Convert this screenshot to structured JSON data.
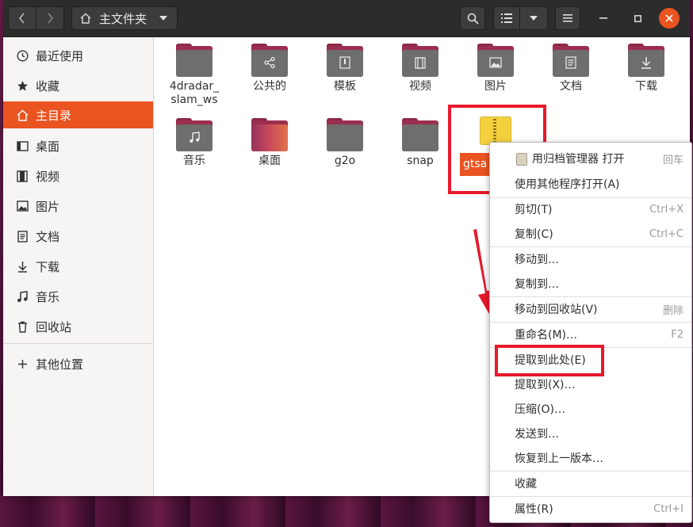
{
  "header": {
    "back_icon": "chevron-left-icon",
    "forward_icon": "chevron-right-icon",
    "path_label": "主文件夹",
    "home_icon": "home-icon"
  },
  "sidebar": {
    "items": [
      {
        "label": "最近使用",
        "icon": "clock-icon"
      },
      {
        "label": "收藏",
        "icon": "star-icon"
      },
      {
        "label": "主目录",
        "icon": "home-icon"
      },
      {
        "label": "桌面",
        "icon": "desktop-icon"
      },
      {
        "label": "视频",
        "icon": "video-icon"
      },
      {
        "label": "图片",
        "icon": "image-icon"
      },
      {
        "label": "文档",
        "icon": "document-icon"
      },
      {
        "label": "下载",
        "icon": "download-icon"
      },
      {
        "label": "音乐",
        "icon": "music-icon"
      },
      {
        "label": "回收站",
        "icon": "trash-icon"
      },
      {
        "label": "其他位置",
        "icon": "plus-icon"
      }
    ]
  },
  "files": [
    {
      "name": "4dradar_\nslam_ws",
      "type": "folder"
    },
    {
      "name": "公共的",
      "type": "folder-share"
    },
    {
      "name": "模板",
      "type": "folder-templates"
    },
    {
      "name": "视频",
      "type": "folder-video"
    },
    {
      "name": "图片",
      "type": "folder-image"
    },
    {
      "name": "文档",
      "type": "folder-document"
    },
    {
      "name": "下载",
      "type": "folder-download"
    },
    {
      "name": "音乐",
      "type": "folder-music"
    },
    {
      "name": "桌面",
      "type": "folder-desktop"
    },
    {
      "name": "g2o",
      "type": "folder"
    },
    {
      "name": "snap",
      "type": "folder"
    },
    {
      "name": "gtsa",
      "type": "archive"
    }
  ],
  "context_menu": {
    "items": [
      {
        "label": "用归档管理器 打开",
        "accel": "回车"
      },
      {
        "label": "使用其他程序打开(A)",
        "accel": ""
      },
      {
        "label": "剪切(T)",
        "accel": "Ctrl+X"
      },
      {
        "label": "复制(C)",
        "accel": "Ctrl+C"
      },
      {
        "label": "移动到…",
        "accel": ""
      },
      {
        "label": "复制到…",
        "accel": ""
      },
      {
        "label": "移动到回收站(V)",
        "accel": "删除"
      },
      {
        "label": "重命名(M)…",
        "accel": "F2"
      },
      {
        "label": "提取到此处(E)",
        "accel": ""
      },
      {
        "label": "提取到(X)…",
        "accel": ""
      },
      {
        "label": "压缩(O)…",
        "accel": ""
      },
      {
        "label": "发送到…",
        "accel": ""
      },
      {
        "label": "恢复到上一版本…",
        "accel": ""
      },
      {
        "label": "收藏",
        "accel": ""
      },
      {
        "label": "属性(R)",
        "accel": "Ctrl+I"
      }
    ]
  },
  "colors": {
    "accent": "#e95420",
    "annotation": "#e8192c",
    "headerbar": "#2c2c2c"
  }
}
